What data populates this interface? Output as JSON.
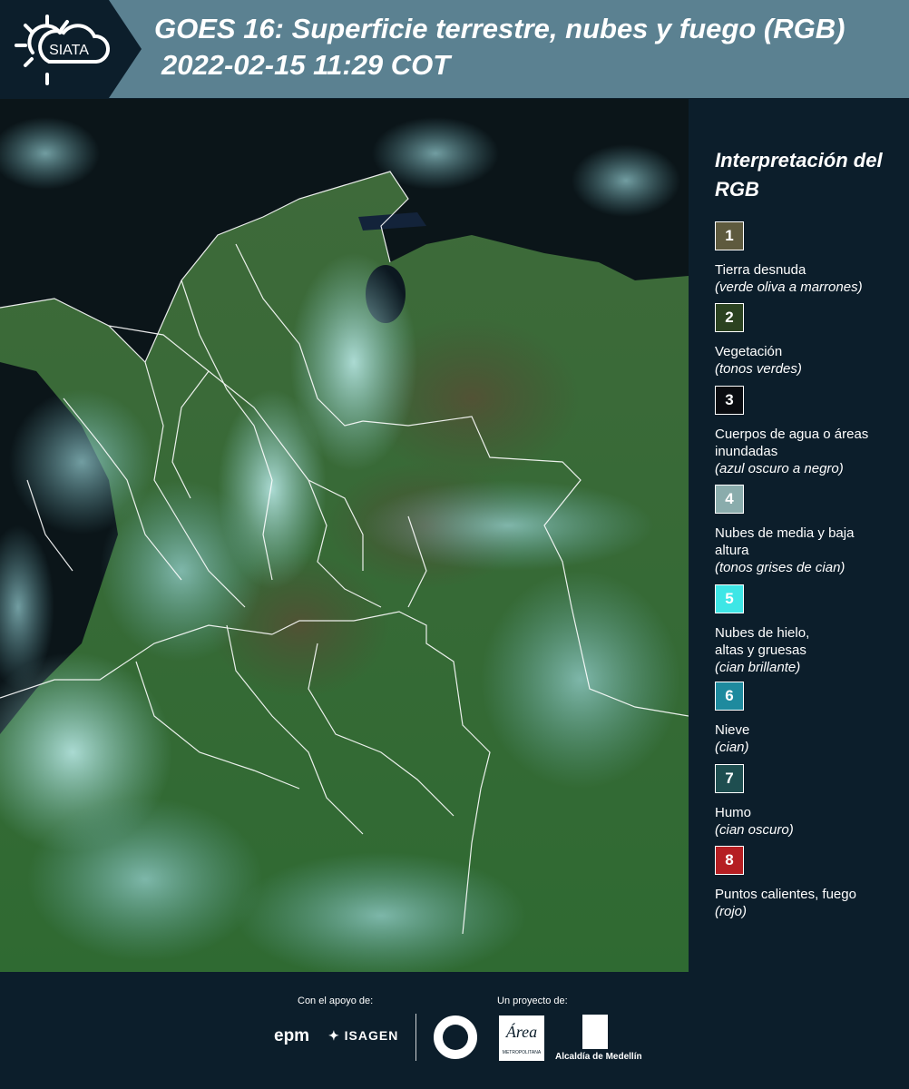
{
  "header": {
    "logo_text": "SIATA",
    "title_line1": "GOES 16: Superficie terrestre, nubes y fuego (RGB)",
    "title_line2": "2022-02-15 11:29 COT"
  },
  "legend": {
    "title": "Interpretación del RGB",
    "items": [
      {
        "num": "1",
        "label": "Tierra desnuda",
        "sub": "(verde oliva a marrones)",
        "color": "#5e5a3e"
      },
      {
        "num": "2",
        "label": "Vegetación",
        "sub": "(tonos verdes)",
        "color": "#2b4220"
      },
      {
        "num": "3",
        "label": "Cuerpos de agua o áreas inundadas",
        "sub": "(azul oscuro a negro)",
        "color": "#0a0c10"
      },
      {
        "num": "4",
        "label": "Nubes de media y baja altura",
        "sub": "(tonos grises de cian)",
        "color": "#8aacac"
      },
      {
        "num": "5",
        "label": "Nubes de hielo, altas y gruesas",
        "sub": "(cian brillante)",
        "color": "#3ee6e6"
      },
      {
        "num": "6",
        "label": "Nieve",
        "sub": "(cian)",
        "color": "#1e8a9e"
      },
      {
        "num": "7",
        "label": "Humo",
        "sub": "(cian oscuro)",
        "color": "#1e4e50"
      },
      {
        "num": "8",
        "label": "Puntos calientes, fuego",
        "sub": "(rojo)",
        "color": "#b51e22"
      }
    ]
  },
  "footer": {
    "support_label": "Con el apoyo de:",
    "project_label": "Un proyecto de:",
    "epm": "epm",
    "isagen": "ISAGEN",
    "area_logo": "Área",
    "area_sub": "METROPOLITANA",
    "alcaldia": "Alcaldía de Medellín"
  }
}
